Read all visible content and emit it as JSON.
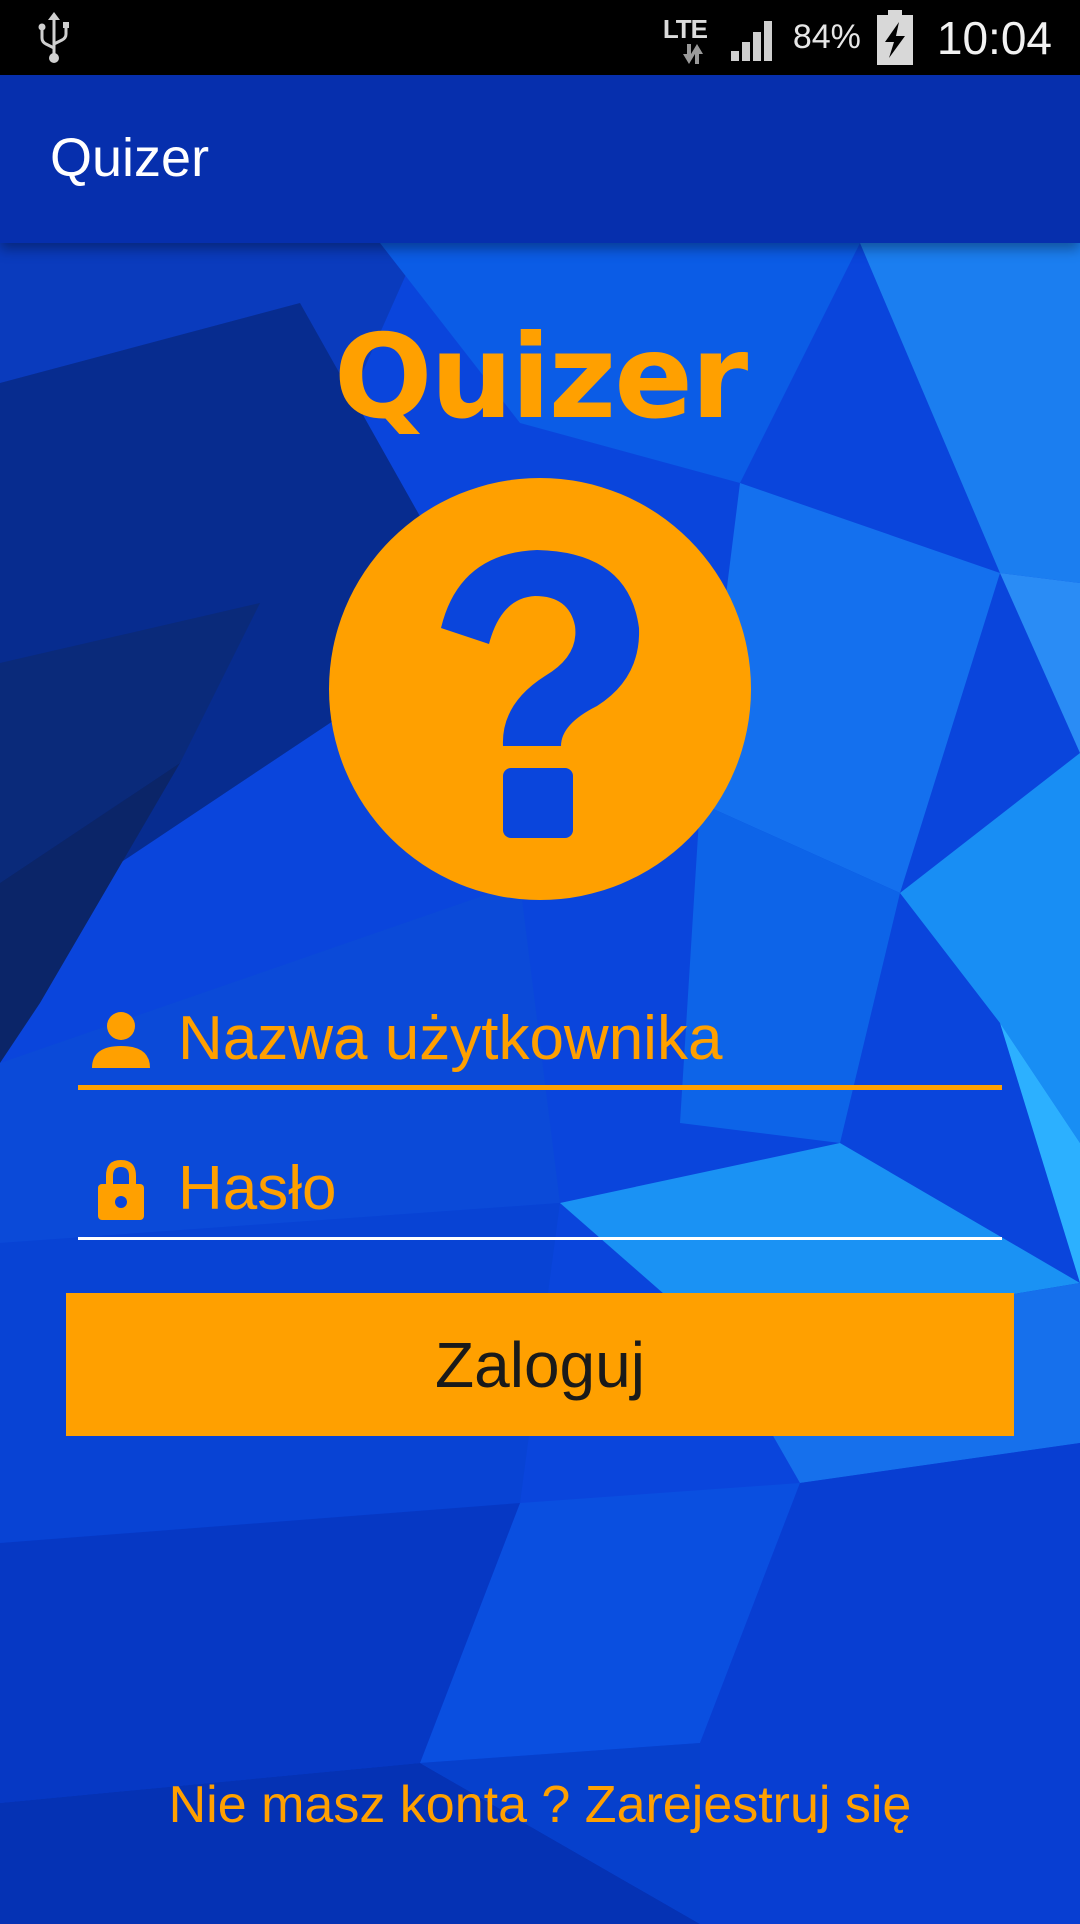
{
  "status_bar": {
    "network_type": "LTE",
    "battery_percent": "84%",
    "time": "10:04",
    "icons": [
      "usb-icon",
      "data-arrows-icon",
      "signal-icon",
      "battery-charging-icon"
    ]
  },
  "app_bar": {
    "title": "Quizer"
  },
  "login": {
    "logo_text": "Quizer",
    "logo_icon": "help-circle-icon",
    "username_placeholder": "Nazwa użytkownika",
    "password_placeholder": "Hasło",
    "login_button": "Zaloguj",
    "register_link": "Nie masz konta ? Zarejestruj się"
  },
  "colors": {
    "accent": "#ffa000",
    "app_bar": "#062fad",
    "background": "#0a3fd6",
    "status_bar": "#000000"
  }
}
